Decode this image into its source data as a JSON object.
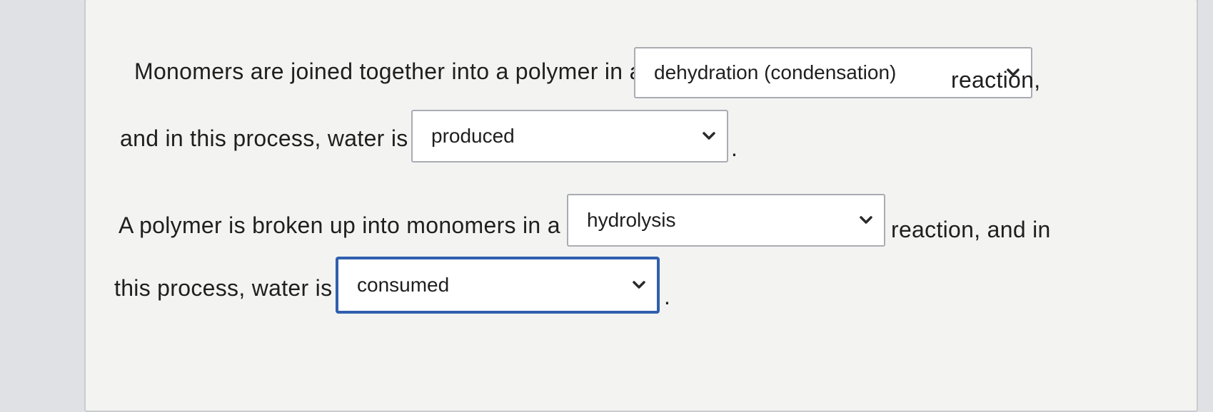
{
  "questions": [
    {
      "text_before": "Monomers are joined together into a polymer in a",
      "select1_value": "dehydration (condensation)",
      "text_middle": "reaction,",
      "text_line2": "and in this process, water is",
      "select2_value": "produced",
      "end": "."
    },
    {
      "text_before": "A polymer is broken up into monomers in a",
      "select1_value": "hydrolysis",
      "text_middle": "reaction, and in",
      "text_line2": "this process, water is",
      "select2_value": "consumed",
      "end": "."
    }
  ],
  "icons": {
    "chevron": "chevron-down-icon"
  },
  "colors": {
    "focus_border": "#2f5fae",
    "select_border": "#a9acb2",
    "text": "#1f1f1f"
  }
}
